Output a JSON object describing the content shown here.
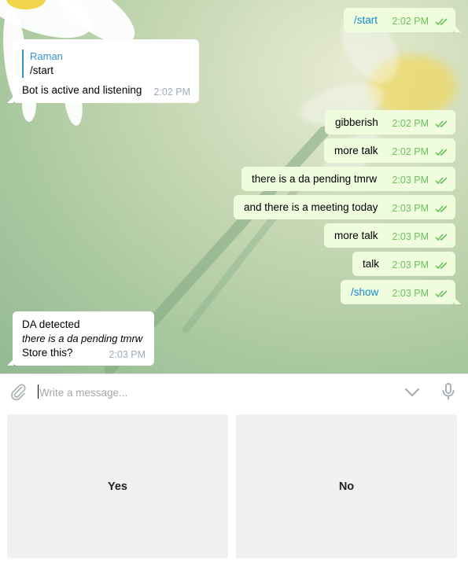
{
  "messages": {
    "m1": {
      "text": "/start",
      "time": "2:02 PM"
    },
    "m2": {
      "reply_author": "Raman",
      "reply_text": "/start",
      "text": "Bot is active and listening",
      "time": "2:02 PM"
    },
    "m3": {
      "text": "gibberish",
      "time": "2:02 PM"
    },
    "m4": {
      "text": "more talk",
      "time": "2:02 PM"
    },
    "m5": {
      "text": "there is a da pending tmrw",
      "time": "2:03 PM"
    },
    "m6": {
      "text": "and there is a meeting today",
      "time": "2:03 PM"
    },
    "m7": {
      "text": "more talk",
      "time": "2:03 PM"
    },
    "m8": {
      "text": "talk",
      "time": "2:03 PM"
    },
    "m9": {
      "text": "/show",
      "time": "2:03 PM"
    },
    "m10": {
      "line1": "DA detected",
      "line2": "there is a da pending tmrw",
      "line3": "Store this?",
      "time": "2:03 PM"
    }
  },
  "composer": {
    "placeholder": "Write a message..."
  },
  "keyboard": {
    "yes_label": "Yes",
    "no_label": "No"
  },
  "colors": {
    "outgoing_bubble": "#effdde",
    "incoming_bubble": "#ffffff",
    "read_check": "#6cbf5b",
    "link": "#168acd",
    "keyboard_button": "#f0f0f0"
  },
  "icons": [
    "attach-icon",
    "chevron-down-icon",
    "microphone-icon",
    "double-check-icon"
  ]
}
